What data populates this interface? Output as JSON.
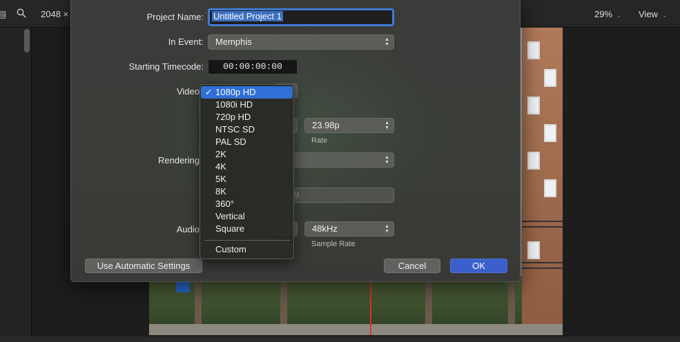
{
  "toolbar": {
    "resolution_text": "2048 ×",
    "zoom": "29%",
    "view_label": "View",
    "chevron": "⌄"
  },
  "dialog": {
    "project_name_label": "Project Name:",
    "project_name_value": "Untitled Project 1",
    "event_label": "In Event:",
    "event_value": "Memphis",
    "timecode_label": "Starting Timecode:",
    "timecode_value": "00:00:00:00",
    "video_label": "Video",
    "rendering_label": "Rendering",
    "audio_label": "Audio",
    "rate_value": "23.98p",
    "rate_caption": "Rate",
    "disabled_value": "9",
    "sample_rate_value": "48kHz",
    "sample_rate_caption": "Sample Rate",
    "auto_settings_button": "Use Automatic Settings",
    "cancel_button": "Cancel",
    "ok_button": "OK"
  },
  "video_menu": {
    "selected": "1080p HD",
    "check": "✓",
    "items": [
      "1080p HD",
      "1080i HD",
      "720p HD",
      "NTSC SD",
      "PAL SD",
      "2K",
      "4K",
      "5K",
      "8K",
      "360°",
      "Vertical",
      "Square"
    ],
    "custom": "Custom"
  },
  "icons": {
    "left_icon": "film-icon",
    "search": "search-icon",
    "popup_arrows": "updown-arrows-icon"
  },
  "colors": {
    "accent": "#3c5fce",
    "menu_selection": "#2f6fd6",
    "focus_ring": "#3e7bd4",
    "playhead": "#e03030"
  }
}
